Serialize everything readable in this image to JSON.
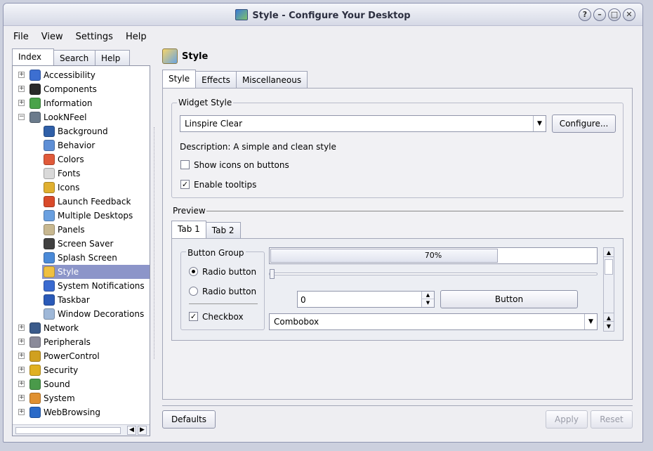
{
  "window": {
    "title": "Style - Configure Your Desktop",
    "buttons": [
      "?",
      "–",
      "□",
      "✕"
    ]
  },
  "menubar": [
    "File",
    "View",
    "Settings",
    "Help"
  ],
  "nav_tabs": [
    "Index",
    "Search",
    "Help"
  ],
  "tree": [
    {
      "label": "Accessibility",
      "icon": "accessibility-icon",
      "color": "#3d6fd1",
      "level": 0,
      "expander": "+"
    },
    {
      "label": "Components",
      "icon": "components-icon",
      "color": "#2a2a2a",
      "level": 0,
      "expander": "+"
    },
    {
      "label": "Information",
      "icon": "information-icon",
      "color": "#4aa34a",
      "level": 0,
      "expander": "+"
    },
    {
      "label": "LookNFeel",
      "icon": "looknfeel-icon",
      "color": "#6b7b8c",
      "level": 0,
      "expander": "−"
    },
    {
      "label": "Background",
      "icon": "background-icon",
      "color": "#2f5fa8",
      "level": 1
    },
    {
      "label": "Behavior",
      "icon": "behavior-icon",
      "color": "#5e8fd6",
      "level": 1
    },
    {
      "label": "Colors",
      "icon": "colors-icon",
      "color": "#e05a3a",
      "level": 1
    },
    {
      "label": "Fonts",
      "icon": "fonts-icon",
      "color": "#d9d9d9",
      "level": 1
    },
    {
      "label": "Icons",
      "icon": "icons-icon",
      "color": "#e0b030",
      "level": 1
    },
    {
      "label": "Launch Feedback",
      "icon": "launch-feedback-icon",
      "color": "#d94a2a",
      "level": 1
    },
    {
      "label": "Multiple Desktops",
      "icon": "multiple-desktops-icon",
      "color": "#6aa0e0",
      "level": 1
    },
    {
      "label": "Panels",
      "icon": "panels-icon",
      "color": "#c8b890",
      "level": 1
    },
    {
      "label": "Screen Saver",
      "icon": "screen-saver-icon",
      "color": "#404040",
      "level": 1
    },
    {
      "label": "Splash Screen",
      "icon": "splash-screen-icon",
      "color": "#4a8ad8",
      "level": 1
    },
    {
      "label": "Style",
      "icon": "style-icon",
      "color": "#f0c040",
      "level": 1,
      "selected": true
    },
    {
      "label": "System Notifications",
      "icon": "system-notifications-icon",
      "color": "#3a6ad0",
      "level": 1
    },
    {
      "label": "Taskbar",
      "icon": "taskbar-icon",
      "color": "#2a5ab8",
      "level": 1
    },
    {
      "label": "Window Decorations",
      "icon": "window-decorations-icon",
      "color": "#9fb8d8",
      "level": 1
    },
    {
      "label": "Network",
      "icon": "network-icon",
      "color": "#3a5a8a",
      "level": 0,
      "expander": "+"
    },
    {
      "label": "Peripherals",
      "icon": "peripherals-icon",
      "color": "#8a8a9a",
      "level": 0,
      "expander": "+"
    },
    {
      "label": "PowerControl",
      "icon": "powercontrol-icon",
      "color": "#d0a020",
      "level": 0,
      "expander": "+"
    },
    {
      "label": "Security",
      "icon": "security-icon",
      "color": "#e0b020",
      "level": 0,
      "expander": "+"
    },
    {
      "label": "Sound",
      "icon": "sound-icon",
      "color": "#4a9a4a",
      "level": 0,
      "expander": "+"
    },
    {
      "label": "System",
      "icon": "system-icon",
      "color": "#e09030",
      "level": 0,
      "expander": "+"
    },
    {
      "label": "WebBrowsing",
      "icon": "webbrowsing-icon",
      "color": "#2a6ac8",
      "level": 0,
      "expander": "+"
    }
  ],
  "page": {
    "title": "Style",
    "tabs": [
      "Style",
      "Effects",
      "Miscellaneous"
    ],
    "widget_style": {
      "group_title": "Widget Style",
      "selected": "Linspire Clear",
      "configure_label": "Configure...",
      "description": "Description: A simple and clean style",
      "show_icons_label": "Show icons on buttons",
      "show_icons_checked": false,
      "tooltips_label": "Enable tooltips",
      "tooltips_checked": true
    },
    "preview": {
      "title": "Preview",
      "tabs": [
        "Tab 1",
        "Tab 2"
      ],
      "button_group_title": "Button Group",
      "radio1": "Radio button",
      "radio2": "Radio button",
      "checkbox": "Checkbox",
      "progress_text": "70%",
      "progress_value": 0.7,
      "spin_value": "0",
      "button_label": "Button",
      "combobox_label": "Combobox"
    }
  },
  "footer": {
    "defaults": "Defaults",
    "apply": "Apply",
    "reset": "Reset"
  }
}
